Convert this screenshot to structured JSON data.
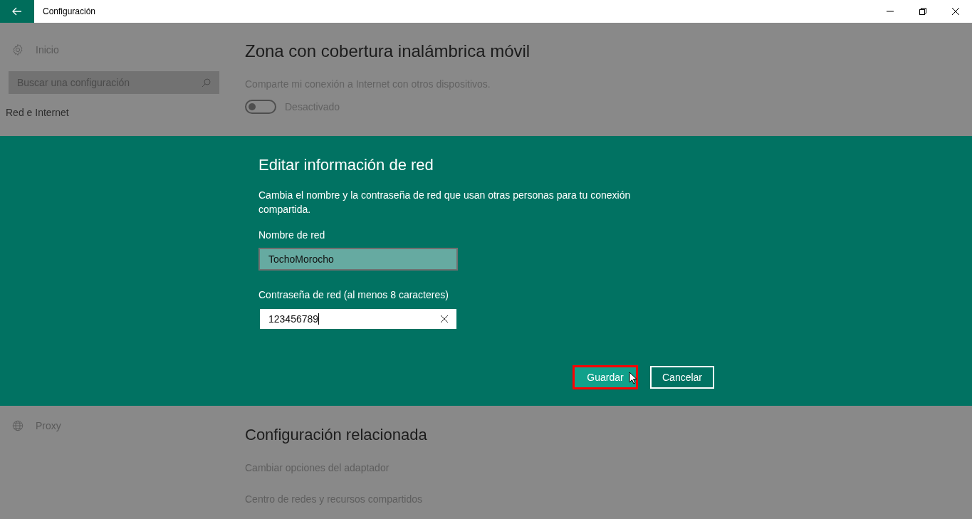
{
  "window": {
    "title": "Configuración"
  },
  "sidebar": {
    "home": "Inicio",
    "search": {
      "placeholder": "Buscar una configuración"
    },
    "section": "Red e Internet",
    "items": [
      {
        "label": "Proxy"
      }
    ]
  },
  "hotspot": {
    "title": "Zona con cobertura inalámbrica móvil",
    "description": "Comparte mi conexión a Internet con otros dispositivos.",
    "toggle": {
      "on": false,
      "label": "Desactivado"
    }
  },
  "dialog": {
    "title": "Editar información de red",
    "description": "Cambia el nombre y la contraseña de red que usan otras personas para tu conexión compartida.",
    "fields": [
      {
        "label": "Nombre de red",
        "value": "TochoMorocho",
        "focused": false
      },
      {
        "label": "Contraseña de red (al menos 8 caracteres)",
        "value": "123456789",
        "focused": true
      }
    ],
    "buttons": [
      {
        "label": "Guardar",
        "kind": "primary",
        "highlighted": true
      },
      {
        "label": "Cancelar",
        "kind": "secondary",
        "highlighted": false
      }
    ]
  },
  "related": {
    "title": "Configuración relacionada",
    "links": [
      "Cambiar opciones del adaptador",
      "Centro de redes y recursos compartidos"
    ]
  }
}
